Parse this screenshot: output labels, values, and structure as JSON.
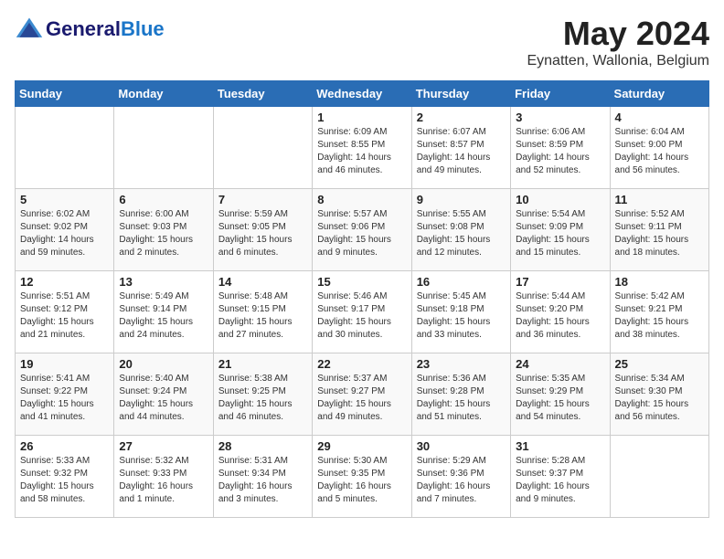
{
  "header": {
    "logo_general": "General",
    "logo_blue": "Blue",
    "month": "May 2024",
    "location": "Eynatten, Wallonia, Belgium"
  },
  "weekdays": [
    "Sunday",
    "Monday",
    "Tuesday",
    "Wednesday",
    "Thursday",
    "Friday",
    "Saturday"
  ],
  "weeks": [
    [
      {
        "day": "",
        "info": ""
      },
      {
        "day": "",
        "info": ""
      },
      {
        "day": "",
        "info": ""
      },
      {
        "day": "1",
        "info": "Sunrise: 6:09 AM\nSunset: 8:55 PM\nDaylight: 14 hours\nand 46 minutes."
      },
      {
        "day": "2",
        "info": "Sunrise: 6:07 AM\nSunset: 8:57 PM\nDaylight: 14 hours\nand 49 minutes."
      },
      {
        "day": "3",
        "info": "Sunrise: 6:06 AM\nSunset: 8:59 PM\nDaylight: 14 hours\nand 52 minutes."
      },
      {
        "day": "4",
        "info": "Sunrise: 6:04 AM\nSunset: 9:00 PM\nDaylight: 14 hours\nand 56 minutes."
      }
    ],
    [
      {
        "day": "5",
        "info": "Sunrise: 6:02 AM\nSunset: 9:02 PM\nDaylight: 14 hours\nand 59 minutes."
      },
      {
        "day": "6",
        "info": "Sunrise: 6:00 AM\nSunset: 9:03 PM\nDaylight: 15 hours\nand 2 minutes."
      },
      {
        "day": "7",
        "info": "Sunrise: 5:59 AM\nSunset: 9:05 PM\nDaylight: 15 hours\nand 6 minutes."
      },
      {
        "day": "8",
        "info": "Sunrise: 5:57 AM\nSunset: 9:06 PM\nDaylight: 15 hours\nand 9 minutes."
      },
      {
        "day": "9",
        "info": "Sunrise: 5:55 AM\nSunset: 9:08 PM\nDaylight: 15 hours\nand 12 minutes."
      },
      {
        "day": "10",
        "info": "Sunrise: 5:54 AM\nSunset: 9:09 PM\nDaylight: 15 hours\nand 15 minutes."
      },
      {
        "day": "11",
        "info": "Sunrise: 5:52 AM\nSunset: 9:11 PM\nDaylight: 15 hours\nand 18 minutes."
      }
    ],
    [
      {
        "day": "12",
        "info": "Sunrise: 5:51 AM\nSunset: 9:12 PM\nDaylight: 15 hours\nand 21 minutes."
      },
      {
        "day": "13",
        "info": "Sunrise: 5:49 AM\nSunset: 9:14 PM\nDaylight: 15 hours\nand 24 minutes."
      },
      {
        "day": "14",
        "info": "Sunrise: 5:48 AM\nSunset: 9:15 PM\nDaylight: 15 hours\nand 27 minutes."
      },
      {
        "day": "15",
        "info": "Sunrise: 5:46 AM\nSunset: 9:17 PM\nDaylight: 15 hours\nand 30 minutes."
      },
      {
        "day": "16",
        "info": "Sunrise: 5:45 AM\nSunset: 9:18 PM\nDaylight: 15 hours\nand 33 minutes."
      },
      {
        "day": "17",
        "info": "Sunrise: 5:44 AM\nSunset: 9:20 PM\nDaylight: 15 hours\nand 36 minutes."
      },
      {
        "day": "18",
        "info": "Sunrise: 5:42 AM\nSunset: 9:21 PM\nDaylight: 15 hours\nand 38 minutes."
      }
    ],
    [
      {
        "day": "19",
        "info": "Sunrise: 5:41 AM\nSunset: 9:22 PM\nDaylight: 15 hours\nand 41 minutes."
      },
      {
        "day": "20",
        "info": "Sunrise: 5:40 AM\nSunset: 9:24 PM\nDaylight: 15 hours\nand 44 minutes."
      },
      {
        "day": "21",
        "info": "Sunrise: 5:38 AM\nSunset: 9:25 PM\nDaylight: 15 hours\nand 46 minutes."
      },
      {
        "day": "22",
        "info": "Sunrise: 5:37 AM\nSunset: 9:27 PM\nDaylight: 15 hours\nand 49 minutes."
      },
      {
        "day": "23",
        "info": "Sunrise: 5:36 AM\nSunset: 9:28 PM\nDaylight: 15 hours\nand 51 minutes."
      },
      {
        "day": "24",
        "info": "Sunrise: 5:35 AM\nSunset: 9:29 PM\nDaylight: 15 hours\nand 54 minutes."
      },
      {
        "day": "25",
        "info": "Sunrise: 5:34 AM\nSunset: 9:30 PM\nDaylight: 15 hours\nand 56 minutes."
      }
    ],
    [
      {
        "day": "26",
        "info": "Sunrise: 5:33 AM\nSunset: 9:32 PM\nDaylight: 15 hours\nand 58 minutes."
      },
      {
        "day": "27",
        "info": "Sunrise: 5:32 AM\nSunset: 9:33 PM\nDaylight: 16 hours\nand 1 minute."
      },
      {
        "day": "28",
        "info": "Sunrise: 5:31 AM\nSunset: 9:34 PM\nDaylight: 16 hours\nand 3 minutes."
      },
      {
        "day": "29",
        "info": "Sunrise: 5:30 AM\nSunset: 9:35 PM\nDaylight: 16 hours\nand 5 minutes."
      },
      {
        "day": "30",
        "info": "Sunrise: 5:29 AM\nSunset: 9:36 PM\nDaylight: 16 hours\nand 7 minutes."
      },
      {
        "day": "31",
        "info": "Sunrise: 5:28 AM\nSunset: 9:37 PM\nDaylight: 16 hours\nand 9 minutes."
      },
      {
        "day": "",
        "info": ""
      }
    ]
  ]
}
